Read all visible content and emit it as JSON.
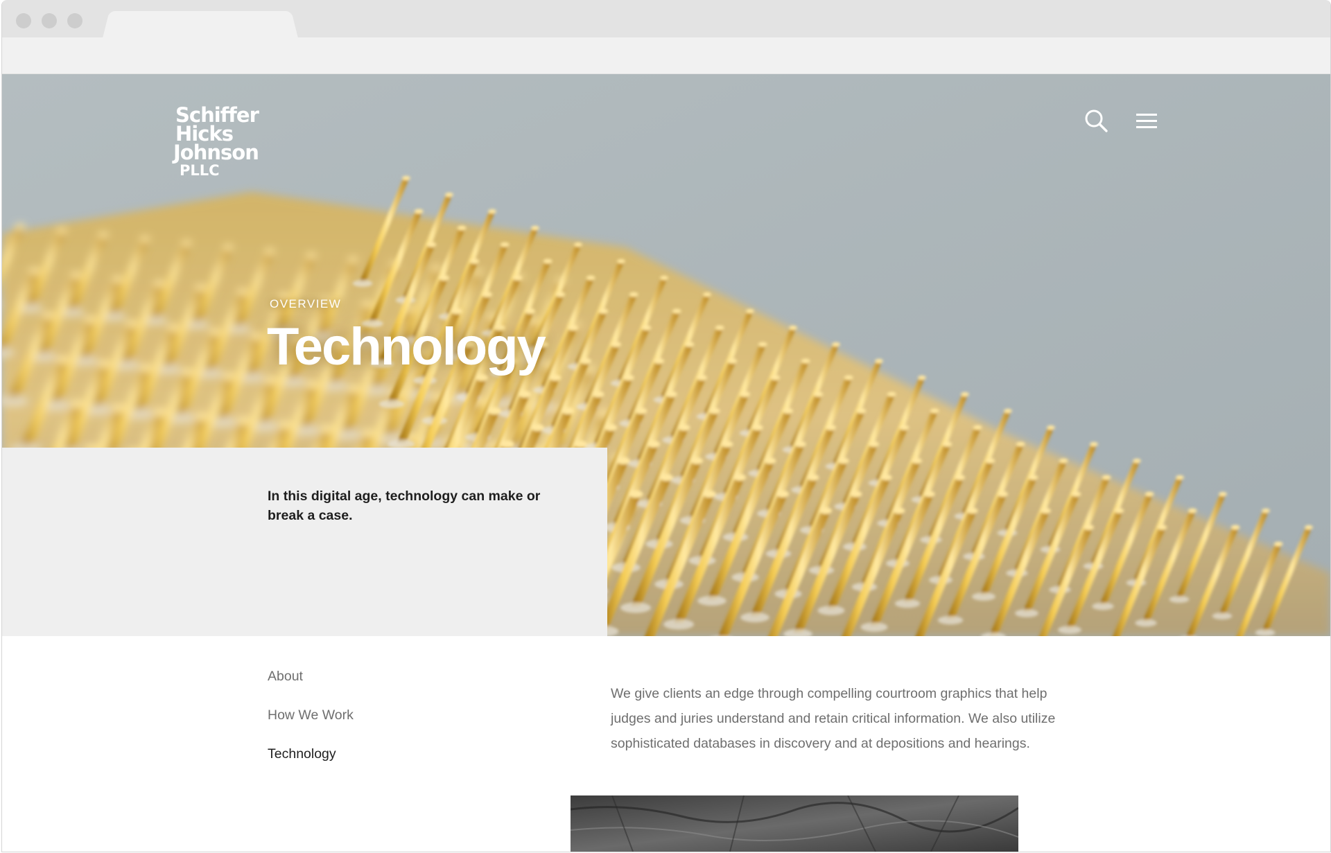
{
  "brand": {
    "logo_lines": [
      "Schiffer",
      "Hicks",
      "Johnson",
      "PLLC"
    ]
  },
  "header": {
    "search_icon": "search-icon",
    "menu_icon": "hamburger-menu-icon"
  },
  "hero": {
    "eyebrow": "OVERVIEW",
    "title": "Technology"
  },
  "intro": {
    "text": "In this digital age, technology can make or break a case."
  },
  "side_nav": {
    "items": [
      {
        "label": "About",
        "active": false
      },
      {
        "label": "How We Work",
        "active": false
      },
      {
        "label": "Technology",
        "active": true
      }
    ]
  },
  "main": {
    "body": "We give clients an edge through compelling courtroom graphics that help judges and juries understand and retain critical information. We also utilize sophisticated databases in discovery and at depositions and hearings."
  },
  "colors": {
    "hero_sky": "#aab4b8",
    "pin_gold": "#e0aa2a",
    "panel_gray": "#efefef",
    "text_dark": "#1e1e1e",
    "text_muted": "#6e6e6e"
  }
}
